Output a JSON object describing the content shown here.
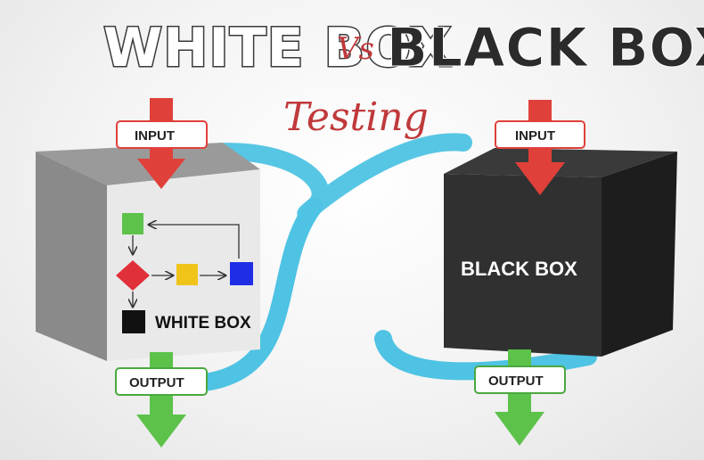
{
  "header": {
    "title_left": "WHITE BOX",
    "title_vs": "Vs",
    "title_right": "BLACK BOX",
    "subtitle": "Testing"
  },
  "white_box": {
    "input_label": "INPUT",
    "output_label": "OUTPUT",
    "box_label": "WHITE BOX"
  },
  "black_box": {
    "input_label": "INPUT",
    "output_label": "OUTPUT",
    "box_label": "BLACK BOX"
  },
  "colors": {
    "input_arrow": "#e0403a",
    "output_arrow": "#5cc24a",
    "curve": "#4ec3e3",
    "label_border": "#4aa83f",
    "flow_green": "#5cc24a",
    "flow_red": "#e0303a",
    "flow_yellow": "#f0c419",
    "flow_blue": "#1f2ee6",
    "flow_black": "#111111"
  }
}
